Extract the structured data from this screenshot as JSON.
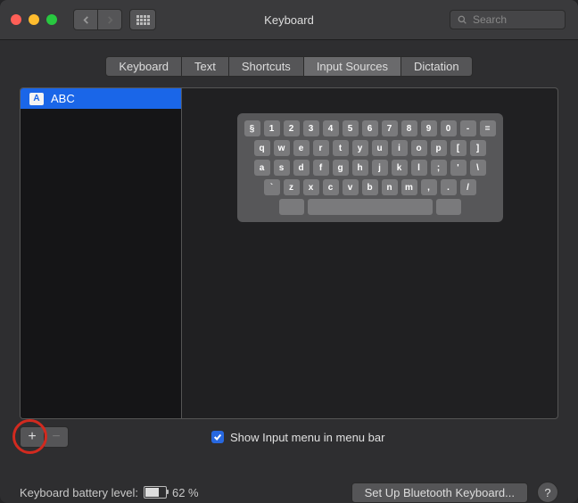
{
  "header": {
    "title": "Keyboard",
    "search_placeholder": "Search"
  },
  "tabs": [
    {
      "label": "Keyboard"
    },
    {
      "label": "Text"
    },
    {
      "label": "Shortcuts"
    },
    {
      "label": "Input Sources",
      "active": true
    },
    {
      "label": "Dictation"
    }
  ],
  "sources": [
    {
      "label": "ABC",
      "icon": "A",
      "selected": true
    }
  ],
  "keyboard_rows": [
    [
      "§",
      "1",
      "2",
      "3",
      "4",
      "5",
      "6",
      "7",
      "8",
      "9",
      "0",
      "-",
      "="
    ],
    [
      "q",
      "w",
      "e",
      "r",
      "t",
      "y",
      "u",
      "i",
      "o",
      "p",
      "[",
      "]"
    ],
    [
      "a",
      "s",
      "d",
      "f",
      "g",
      "h",
      "j",
      "k",
      "l",
      ";",
      "'",
      "\\"
    ],
    [
      "`",
      "z",
      "x",
      "c",
      "v",
      "b",
      "n",
      "m",
      ",",
      ".",
      "/"
    ]
  ],
  "controls": {
    "plus": "+",
    "minus": "−",
    "show_menu_label": "Show Input menu in menu bar",
    "show_menu_checked": true
  },
  "bottom": {
    "battery_label": "Keyboard battery level:",
    "battery_pct": "62 %",
    "bluetooth_btn": "Set Up Bluetooth Keyboard...",
    "help": "?"
  }
}
